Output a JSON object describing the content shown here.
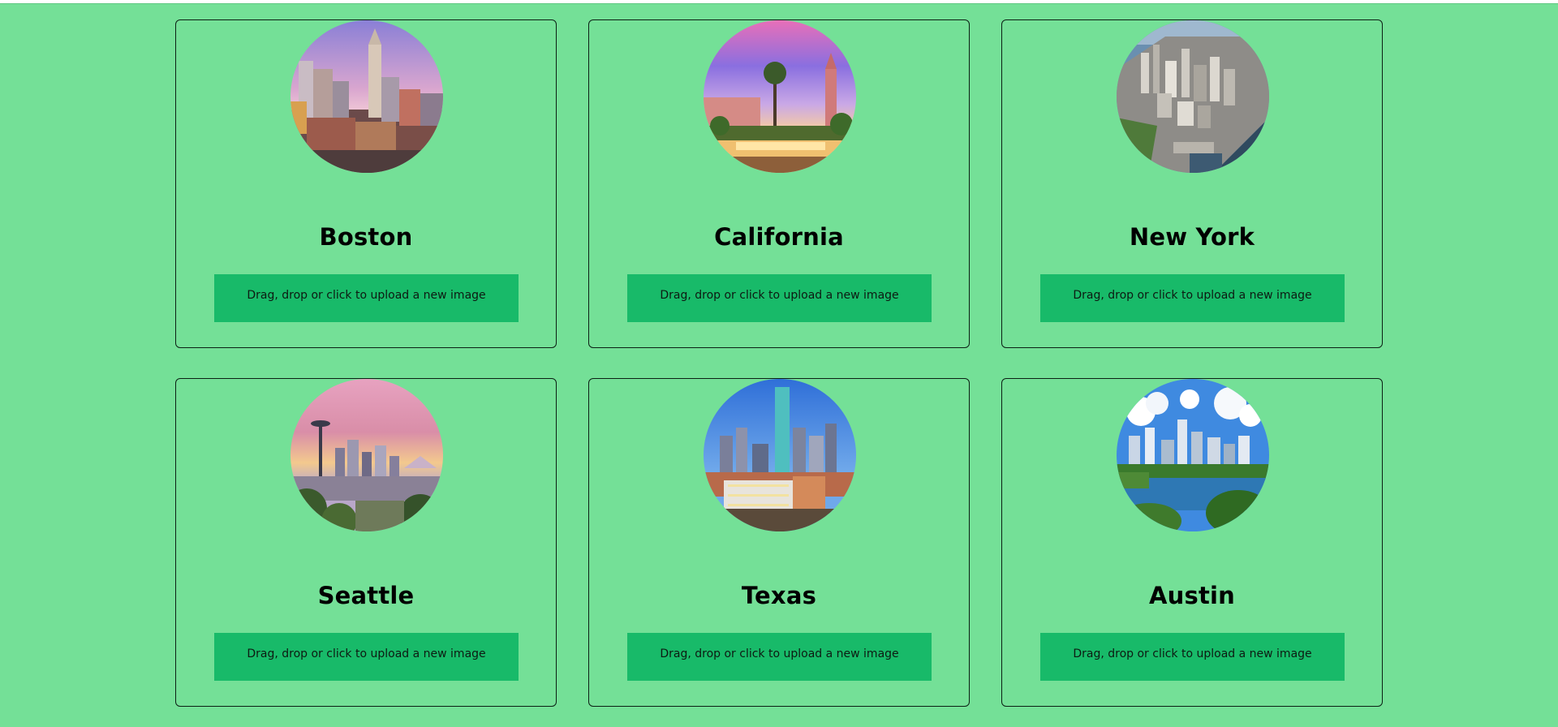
{
  "colors": {
    "background": "#74e097",
    "card_border": "#0c2015",
    "upload_button": "#18ba69"
  },
  "cards": [
    {
      "city": "Boston",
      "upload_label": "Drag, drop or click to upload a new image"
    },
    {
      "city": "California",
      "upload_label": "Drag, drop or click to upload a new image"
    },
    {
      "city": "New York",
      "upload_label": "Drag, drop or click to upload a new image"
    },
    {
      "city": "Seattle",
      "upload_label": "Drag, drop or click to upload a new image"
    },
    {
      "city": "Texas",
      "upload_label": "Drag, drop or click to upload a new image"
    },
    {
      "city": "Austin",
      "upload_label": "Drag, drop or click to upload a new image"
    }
  ]
}
